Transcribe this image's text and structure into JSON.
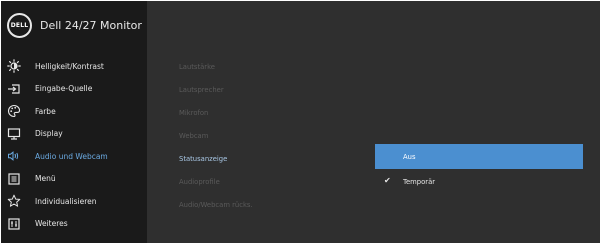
{
  "header": {
    "logo_text": "DELL",
    "title": "Dell 24/27 Monitor"
  },
  "nav": {
    "items": [
      {
        "label": "Helligkeit/Kontrast",
        "icon": "brightness-icon"
      },
      {
        "label": "Eingabe-Quelle",
        "icon": "input-source-icon"
      },
      {
        "label": "Farbe",
        "icon": "color-palette-icon"
      },
      {
        "label": "Display",
        "icon": "display-icon"
      },
      {
        "label": "Audio und Webcam",
        "icon": "audio-webcam-icon",
        "active": true
      },
      {
        "label": "Menü",
        "icon": "menu-icon"
      },
      {
        "label": "Individualisieren",
        "icon": "star-icon"
      },
      {
        "label": "Weiteres",
        "icon": "others-icon"
      }
    ]
  },
  "submenu": {
    "items": [
      {
        "label": "Lautstärke"
      },
      {
        "label": "Lautsprecher"
      },
      {
        "label": "Mikrofon"
      },
      {
        "label": "Webcam"
      },
      {
        "label": "Statusanzeige",
        "active": true
      },
      {
        "label": "Audioprofile"
      },
      {
        "label": "Audio/Webcam rücks."
      }
    ]
  },
  "options": {
    "items": [
      {
        "label": "Aus",
        "highlighted": true
      },
      {
        "label": "Temporär",
        "checked": true
      }
    ]
  },
  "colors": {
    "left_panel": "#1a1a1a",
    "right_panel": "#2f2f2f",
    "accent": "#4b8fd0",
    "active_text": "#6aa9e0",
    "dim_text": "#5a5a5a"
  }
}
